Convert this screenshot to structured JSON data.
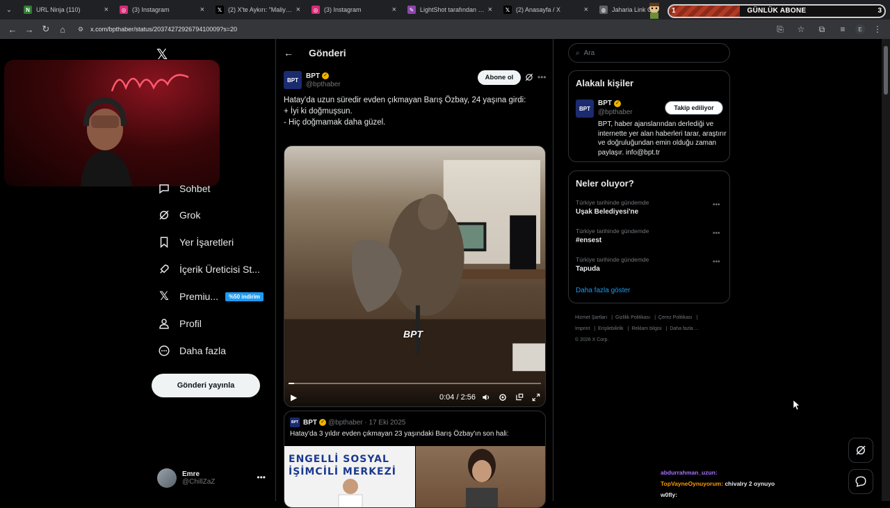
{
  "browser": {
    "tabs": [
      {
        "title": "URL Ninja (110)",
        "favicon": "ninja-icon",
        "color": "#2e7d32"
      },
      {
        "title": "(3) Instagram",
        "favicon": "instagram-icon",
        "color": "#d62976"
      },
      {
        "title": "(2) X'te Aykırı: \"Maliye ek",
        "favicon": "x-icon",
        "color": "#000000"
      },
      {
        "title": "(3) Instagram",
        "favicon": "instagram-icon",
        "color": "#d62976"
      },
      {
        "title": "LightShot tarafından Ekra",
        "favicon": "feather-icon",
        "color": "#8e44ad"
      },
      {
        "title": "(2) Anasayfa / X",
        "favicon": "x-icon",
        "color": "#000000"
      },
      {
        "title": "Jaharia Link C",
        "favicon": "globe-icon",
        "color": "#5f6368"
      }
    ],
    "url": "x.com/bpthaber/status/2037427292679410009?s=20"
  },
  "overlay": {
    "sub_goal": {
      "label": "GÜNLÜK ABONE",
      "current": "1",
      "target": "3",
      "progress": 0.33
    }
  },
  "nav": {
    "items": [
      {
        "label": "Sohbet",
        "icon": "chat-icon"
      },
      {
        "label": "Grok",
        "icon": "grok-icon"
      },
      {
        "label": "Yer İşaretleri",
        "icon": "bookmark-icon"
      },
      {
        "label": "İçerik Üreticisi St...",
        "icon": "rocket-icon"
      },
      {
        "label": "Premiu...",
        "icon": "x-premium-icon",
        "badge": "%50 indirim"
      },
      {
        "label": "Profil",
        "icon": "person-icon"
      },
      {
        "label": "Daha fazla",
        "icon": "more-circle-icon"
      }
    ],
    "post_button": "Gönderi yayınla",
    "account": {
      "name": "Emre",
      "handle": "@ChillZaZ"
    }
  },
  "post": {
    "header": "Gönderi",
    "author": {
      "name": "BPT",
      "handle": "@bpthaber",
      "avatar": "BPT"
    },
    "follow_label": "Abone ol",
    "text_lines": [
      "Hatay'da uzun süredir evden çıkmayan Barış Özbay, 24 yaşına girdi:",
      "",
      "+ İyi ki doğmuşsun.",
      "- Hiç doğmamak daha güzel."
    ],
    "video": {
      "current": "0:04",
      "duration": "2:56",
      "time_label": "0:04 / 2:56",
      "watermark": "BPT",
      "progress": 0.023
    },
    "quoted": {
      "name": "BPT",
      "handle": "@bpthaber",
      "date": "17 Eki 2025",
      "meta": "@bpthaber · 17 Eki 2025",
      "text": "Hatay'da 3 yıldır evden çıkmayan 23 yaşındaki Barış Özbay'ın son hali:",
      "image_sign": "ENGELLİ SOSYAL\nİŞİMCİLİ MERKEZİ"
    }
  },
  "sidebar": {
    "search_placeholder": "Ara",
    "related": {
      "title": "Alakalı kişiler",
      "name": "BPT",
      "handle": "@bpthaber",
      "button": "Takip ediliyor",
      "bio": "BPT, haber ajanslarından derlediği ve internette yer alan haberleri tarar, araştırır ve doğruluğundan emin olduğu zaman paylaşır. info@bpt.tr"
    },
    "trends": {
      "title": "Neler oluyor?",
      "items": [
        {
          "context": "Türkiye tarihinde gündemde",
          "name": "Uşak Belediyesi'ne"
        },
        {
          "context": "Türkiye tarihinde gündemde",
          "name": "#ensest"
        },
        {
          "context": "Türkiye tarihinde gündemde",
          "name": "Tapuda"
        }
      ],
      "show_more": "Daha fazla göster"
    },
    "footer": [
      "Hizmet Şartları",
      "Gizlilik Politikası",
      "Çerez Politikası",
      "Imprint",
      "Erişilebilirlik",
      "Reklam bilgisi",
      "Daha fazla ...",
      "© 2026 X Corp."
    ]
  },
  "chat": [
    {
      "user": "abdurrahman_uzun:",
      "message": "",
      "color": "#a970ff"
    },
    {
      "user": "TopVayneOynuyorum:",
      "message": "chivalry 2 oynuyo",
      "color": "#ff9900"
    },
    {
      "user": "w0fly:",
      "message": "",
      "color": "#e7e9ea"
    }
  ],
  "colors": {
    "accent": "#1d9bf0",
    "background": "#000000",
    "verified": "#f0b400"
  }
}
